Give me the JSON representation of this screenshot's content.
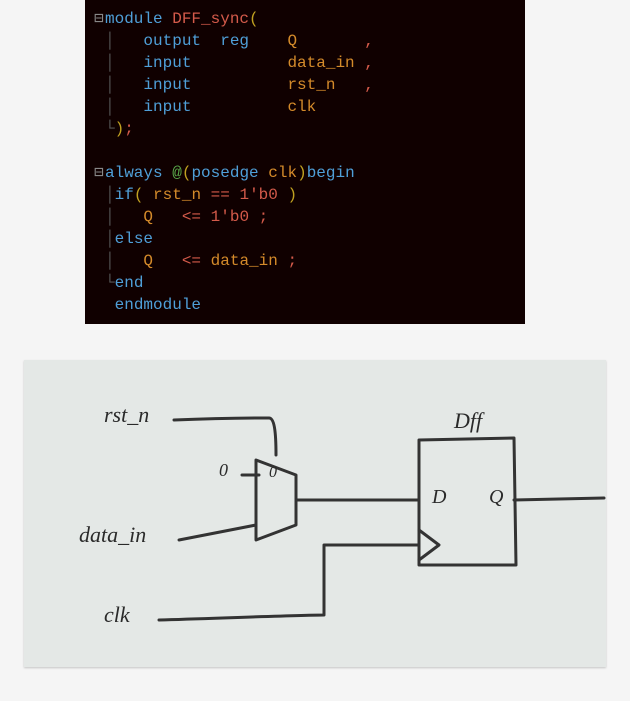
{
  "code": {
    "lines": {
      "l1": {
        "fold": "⊟",
        "kw_module": "module",
        "name": "DFF_sync",
        "open": "("
      },
      "l2": {
        "kw_output": "output",
        "kw_reg": "reg",
        "sig": "Q",
        "comma": ","
      },
      "l3": {
        "kw_input": "input",
        "sig": "data_in",
        "comma": ","
      },
      "l4": {
        "kw_input": "input",
        "sig": "rst_n",
        "comma": ","
      },
      "l5": {
        "kw_input": "input",
        "sig": "clk"
      },
      "l6": {
        "close": ")",
        "semi": ";"
      },
      "l7": {
        "blank": ""
      },
      "l8": {
        "fold": "⊟",
        "kw_always": "always",
        "at": "@",
        "open": "(",
        "kw_posedge": "posedge",
        "sig": "clk",
        "close": ")",
        "kw_begin": "begin"
      },
      "l9": {
        "kw_if": "if",
        "open": "(",
        "sig": "rst_n",
        "op": "==",
        "lit": "1'b0",
        "close": ")"
      },
      "l10": {
        "sig": "Q",
        "op": "<=",
        "lit": "1'b0",
        "semi": ";"
      },
      "l11": {
        "kw_else": "else"
      },
      "l12": {
        "sig": "Q",
        "op": "<=",
        "rhs": "data_in",
        "semi": ";"
      },
      "l13": {
        "bracket_end": "└",
        "kw_end": "end"
      },
      "l14": {
        "kw_endmodule": "endmodule"
      }
    }
  },
  "sketch": {
    "labels": {
      "rst_n": "rst_n",
      "zero": "0",
      "mux_zero": "0",
      "data_in": "data_in",
      "clk": "clk",
      "dff_title": "Dff",
      "d": "D",
      "q": "Q"
    }
  }
}
